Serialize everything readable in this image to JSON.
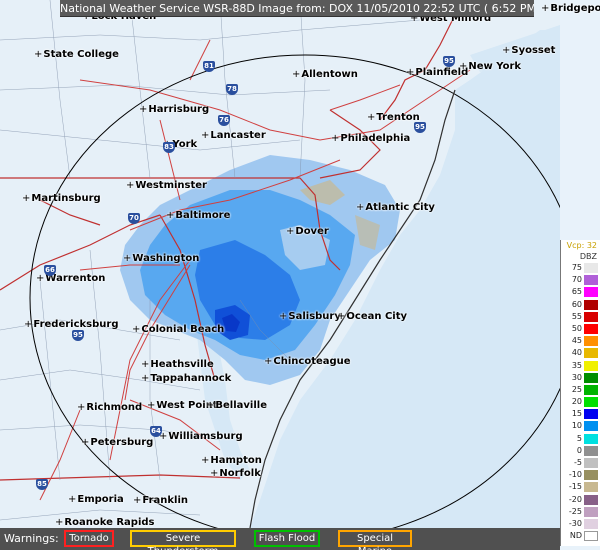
{
  "header": {
    "title": "National Weather Service WSR-88D Image from: DOX 11/05/2010  22:52 UTC  ( 6:52 PM EDT)"
  },
  "legend": {
    "product": "Vcp: 32",
    "unit": "DBZ",
    "levels": [
      {
        "label": "75",
        "color": "#e8e8e8"
      },
      {
        "label": "70",
        "color": "#b060d8"
      },
      {
        "label": "65",
        "color": "#ff00ff"
      },
      {
        "label": "60",
        "color": "#b00000"
      },
      {
        "label": "55",
        "color": "#d80000"
      },
      {
        "label": "50",
        "color": "#ff0000"
      },
      {
        "label": "45",
        "color": "#ff9000"
      },
      {
        "label": "40",
        "color": "#e8b800"
      },
      {
        "label": "35",
        "color": "#f0f000"
      },
      {
        "label": "30",
        "color": "#008e00"
      },
      {
        "label": "25",
        "color": "#00b400"
      },
      {
        "label": "20",
        "color": "#00e000"
      },
      {
        "label": "15",
        "color": "#0000f0"
      },
      {
        "label": "10",
        "color": "#0090f0"
      },
      {
        "label": "5",
        "color": "#00e0e0"
      },
      {
        "label": "0",
        "color": "#909090"
      },
      {
        "label": "-5",
        "color": "#c0c0c0"
      },
      {
        "label": "-10",
        "color": "#989060"
      },
      {
        "label": "-15",
        "color": "#c8b890"
      },
      {
        "label": "-20",
        "color": "#886088"
      },
      {
        "label": "-25",
        "color": "#c0a0c0"
      },
      {
        "label": "-30",
        "color": "#e0d0e0"
      },
      {
        "label": "ND",
        "color": "#ffffff"
      }
    ]
  },
  "warnings": {
    "label": "Warnings:",
    "items": [
      {
        "name": "Tornado",
        "color": "#ff2020"
      },
      {
        "name": "Severe Thunderstorm",
        "color": "#ffcc00"
      },
      {
        "name": "Flash Flood",
        "color": "#00c000"
      },
      {
        "name": "Special Marine",
        "color": "#ffa500"
      }
    ]
  },
  "cities": [
    "Bridgeport",
    "West Milford",
    "Lock Haven",
    "State College",
    "Allentown",
    "Plainfield",
    "Syosset",
    "New York",
    "Harrisburg",
    "Lancaster",
    "Trenton",
    "Philadelphia",
    "York",
    "Westminster",
    "Martinsburg",
    "Baltimore",
    "Atlantic City",
    "Dover",
    "Washington",
    "Warrenton",
    "Fredericksburg",
    "Colonial Beach",
    "Salisbury",
    "Ocean City",
    "Heathsville",
    "Tappahannock",
    "Chincoteague",
    "Richmond",
    "West Point",
    "Bellaville",
    "Williamsburg",
    "Petersburg",
    "Hampton",
    "Norfolk",
    "Emporia",
    "Franklin",
    "Roanoke Rapids"
  ],
  "shields": [
    "81",
    "78",
    "76",
    "83",
    "95",
    "70",
    "66",
    "95",
    "64",
    "85",
    "95"
  ]
}
